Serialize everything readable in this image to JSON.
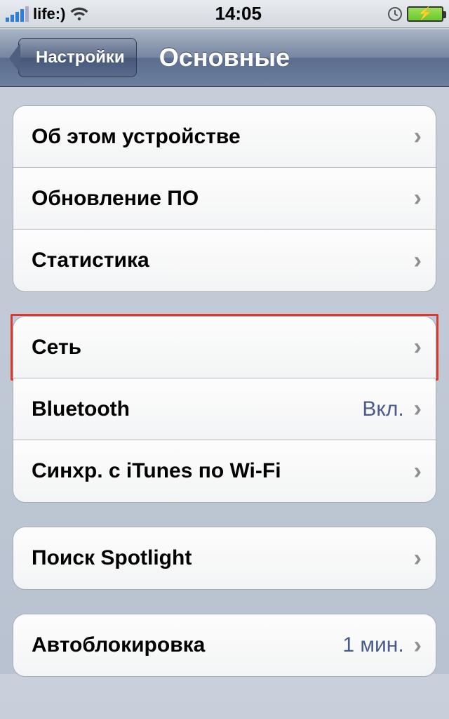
{
  "status": {
    "carrier": "life:)",
    "time": "14:05"
  },
  "nav": {
    "back": "Настройки",
    "title": "Основные"
  },
  "group1": {
    "about": "Об этом устройстве",
    "update": "Обновление ПО",
    "stats": "Статистика"
  },
  "group2": {
    "network": "Сеть",
    "bluetooth": "Bluetooth",
    "bluetooth_value": "Вкл.",
    "itunes": "Синхр. с iTunes по Wi-Fi"
  },
  "group3": {
    "spotlight": "Поиск Spotlight"
  },
  "group4": {
    "autolock": "Автоблокировка",
    "autolock_value": "1 мин."
  }
}
